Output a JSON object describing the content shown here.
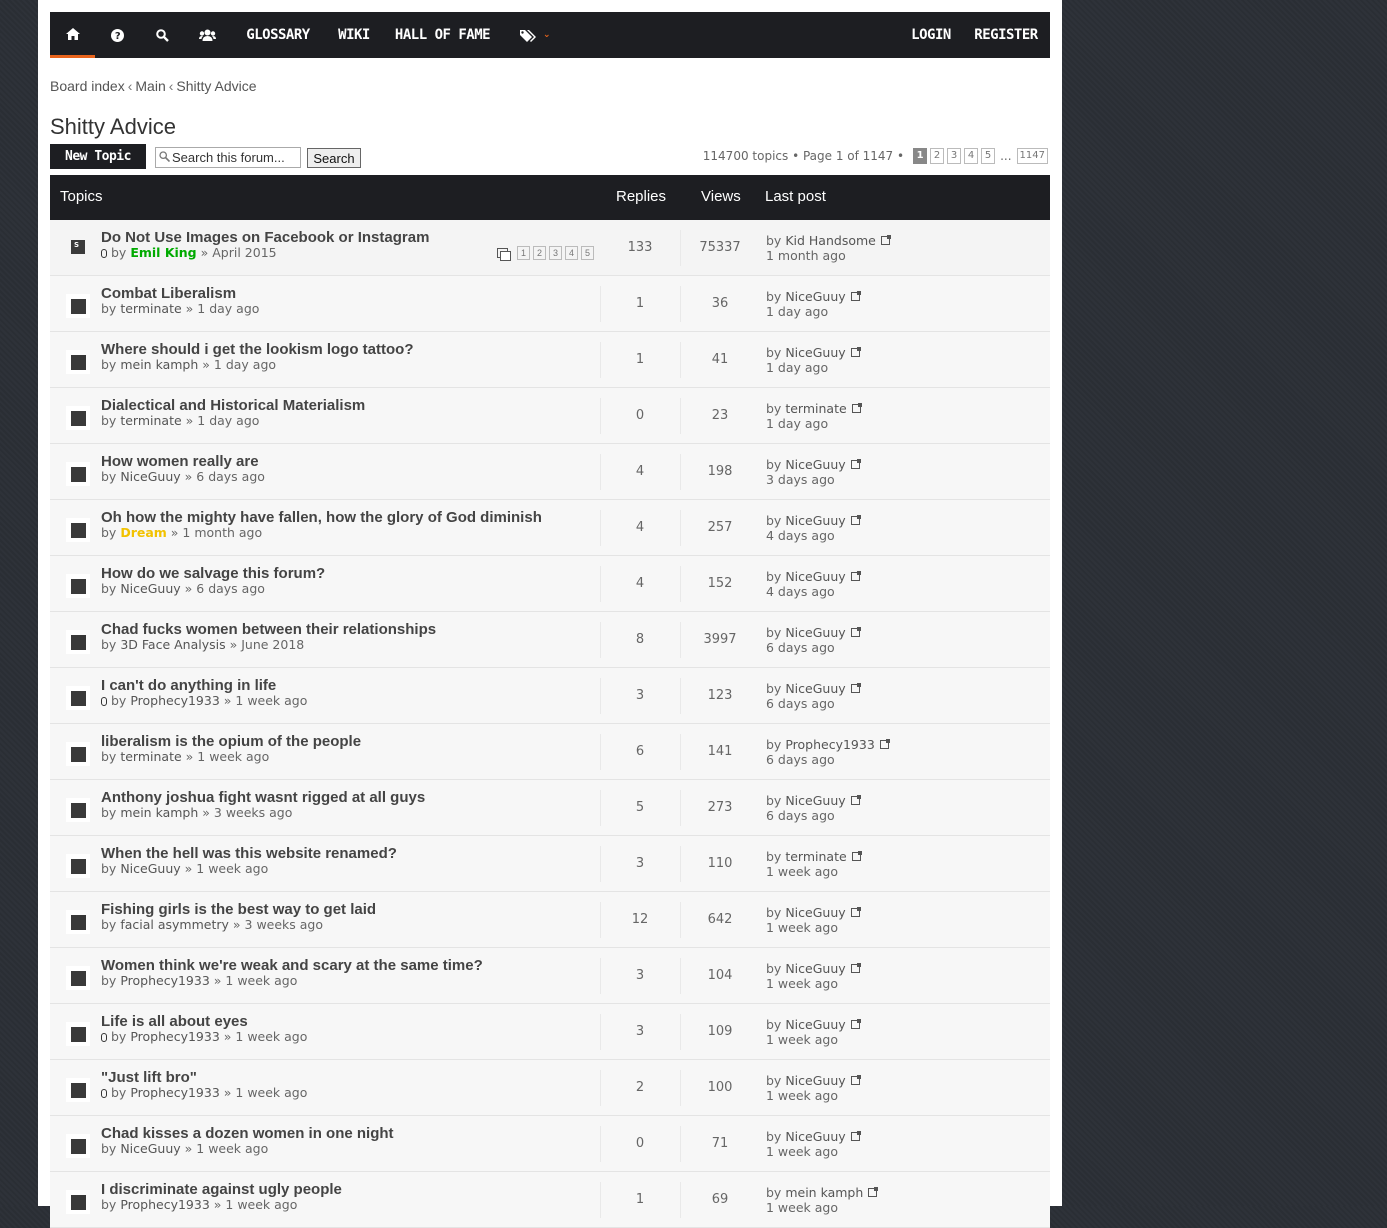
{
  "nav": {
    "items": [
      {
        "label": "",
        "icon": "home-icon"
      },
      {
        "label": "",
        "icon": "help-icon"
      },
      {
        "label": "",
        "icon": "search-icon"
      },
      {
        "label": "",
        "icon": "users-icon"
      },
      {
        "label": "GLOSSARY"
      },
      {
        "label": "WIKI"
      },
      {
        "label": "HALL OF FAME"
      },
      {
        "label": "",
        "icon": "tags-icon"
      }
    ],
    "login": "LOGIN",
    "register": "REGISTER",
    "accent": "#e9641c"
  },
  "breadcrumb": {
    "items": [
      "Board index",
      "Main",
      "Shitty Advice"
    ],
    "separator": "‹"
  },
  "forum": {
    "title": "Shitty Advice"
  },
  "actions": {
    "new_topic": "New Topic",
    "search_placeholder": "Search this forum...",
    "search_button": "Search"
  },
  "pagination": {
    "info": "114700 topics • Page 1 of 1147 •",
    "pages": [
      "1",
      "2",
      "3",
      "4",
      "5"
    ],
    "ellipsis": "...",
    "last": "1147"
  },
  "table": {
    "headers": {
      "topics": "Topics",
      "replies": "Replies",
      "views": "Views",
      "last_post": "Last post"
    },
    "rows": [
      {
        "title": "Do Not Use Images on Facebook or Instagram",
        "by": "by",
        "author": "Emil King",
        "author_color": "green",
        "date": "April 2015",
        "replies": "133",
        "views": "75337",
        "lp_by": "by",
        "lp_author": "Kid Handsome",
        "lp_time": "1 month ago",
        "attachment": true,
        "sticky": true,
        "pages": [
          "1",
          "2",
          "3",
          "4",
          "5"
        ]
      },
      {
        "title": "Combat Liberalism",
        "by": "by",
        "author": "terminate",
        "date": "1 day ago",
        "replies": "1",
        "views": "36",
        "lp_by": "by",
        "lp_author": "NiceGuuy",
        "lp_time": "1 day ago"
      },
      {
        "title": "Where should i get the lookism logo tattoo?",
        "by": "by",
        "author": "mein kamph",
        "date": "1 day ago",
        "replies": "1",
        "views": "41",
        "lp_by": "by",
        "lp_author": "NiceGuuy",
        "lp_time": "1 day ago"
      },
      {
        "title": "Dialectical and Historical Materialism",
        "by": "by",
        "author": "terminate",
        "date": "1 day ago",
        "replies": "0",
        "views": "23",
        "lp_by": "by",
        "lp_author": "terminate",
        "lp_time": "1 day ago"
      },
      {
        "title": "How women really are",
        "by": "by",
        "author": "NiceGuuy",
        "date": "6 days ago",
        "replies": "4",
        "views": "198",
        "lp_by": "by",
        "lp_author": "NiceGuuy",
        "lp_time": "3 days ago"
      },
      {
        "title": "Oh how the mighty have fallen, how the glory of God diminish",
        "by": "by",
        "author": "Dream",
        "author_color": "yellow",
        "date": "1 month ago",
        "replies": "4",
        "views": "257",
        "lp_by": "by",
        "lp_author": "NiceGuuy",
        "lp_time": "4 days ago"
      },
      {
        "title": "How do we salvage this forum?",
        "by": "by",
        "author": "NiceGuuy",
        "date": "6 days ago",
        "replies": "4",
        "views": "152",
        "lp_by": "by",
        "lp_author": "NiceGuuy",
        "lp_time": "4 days ago"
      },
      {
        "title": "Chad fucks women between their relationships",
        "by": "by",
        "author": "3D Face Analysis",
        "date": "June 2018",
        "replies": "8",
        "views": "3997",
        "lp_by": "by",
        "lp_author": "NiceGuuy",
        "lp_time": "6 days ago"
      },
      {
        "title": "I can't do anything in life",
        "by": "by",
        "author": "Prophecy1933",
        "date": "1 week ago",
        "replies": "3",
        "views": "123",
        "lp_by": "by",
        "lp_author": "NiceGuuy",
        "lp_time": "6 days ago",
        "attachment": true
      },
      {
        "title": "liberalism is the opium of the people",
        "by": "by",
        "author": "terminate",
        "date": "1 week ago",
        "replies": "6",
        "views": "141",
        "lp_by": "by",
        "lp_author": "Prophecy1933",
        "lp_time": "6 days ago"
      },
      {
        "title": "Anthony joshua fight wasnt rigged at all guys",
        "by": "by",
        "author": "mein kamph",
        "date": "3 weeks ago",
        "replies": "5",
        "views": "273",
        "lp_by": "by",
        "lp_author": "NiceGuuy",
        "lp_time": "6 days ago"
      },
      {
        "title": "When the hell was this website renamed?",
        "by": "by",
        "author": "NiceGuuy",
        "date": "1 week ago",
        "replies": "3",
        "views": "110",
        "lp_by": "by",
        "lp_author": "terminate",
        "lp_time": "1 week ago"
      },
      {
        "title": "Fishing girls is the best way to get laid",
        "by": "by",
        "author": "facial asymmetry",
        "date": "3 weeks ago",
        "replies": "12",
        "views": "642",
        "lp_by": "by",
        "lp_author": "NiceGuuy",
        "lp_time": "1 week ago"
      },
      {
        "title": "Women think we're weak and scary at the same time?",
        "by": "by",
        "author": "Prophecy1933",
        "date": "1 week ago",
        "replies": "3",
        "views": "104",
        "lp_by": "by",
        "lp_author": "NiceGuuy",
        "lp_time": "1 week ago"
      },
      {
        "title": "Life is all about eyes",
        "by": "by",
        "author": "Prophecy1933",
        "date": "1 week ago",
        "replies": "3",
        "views": "109",
        "lp_by": "by",
        "lp_author": "NiceGuuy",
        "lp_time": "1 week ago",
        "attachment": true
      },
      {
        "title": "\"Just lift bro\"",
        "by": "by",
        "author": "Prophecy1933",
        "date": "1 week ago",
        "replies": "2",
        "views": "100",
        "lp_by": "by",
        "lp_author": "NiceGuuy",
        "lp_time": "1 week ago",
        "attachment": true
      },
      {
        "title": "Chad kisses a dozen women in one night",
        "by": "by",
        "author": "NiceGuuy",
        "date": "1 week ago",
        "replies": "0",
        "views": "71",
        "lp_by": "by",
        "lp_author": "NiceGuuy",
        "lp_time": "1 week ago"
      },
      {
        "title": "I discriminate against ugly people",
        "by": "by",
        "author": "Prophecy1933",
        "date": "1 week ago",
        "replies": "1",
        "views": "69",
        "lp_by": "by",
        "lp_author": "mein kamph",
        "lp_time": "1 week ago"
      }
    ]
  }
}
